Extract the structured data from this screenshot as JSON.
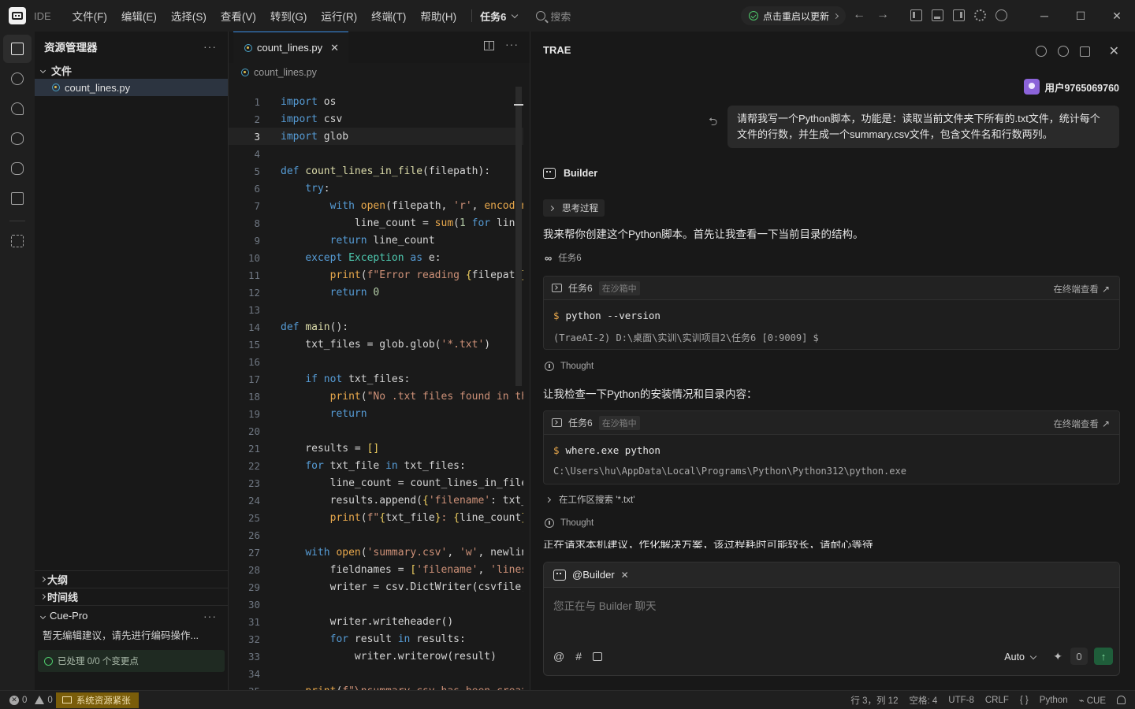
{
  "titlebar": {
    "ide_label": "IDE",
    "menu": [
      "文件(F)",
      "编辑(E)",
      "选择(S)",
      "查看(V)",
      "转到(G)",
      "运行(R)",
      "终端(T)",
      "帮助(H)"
    ],
    "task_title": "任务6",
    "search_placeholder": "搜索",
    "update_text": "点击重启以更新",
    "minimize": "─",
    "maximize": "☐",
    "close": "✕"
  },
  "explorer": {
    "title": "资源管理器",
    "folder": "文件",
    "files": [
      "count_lines.py"
    ],
    "sections": [
      "大纲",
      "时间线"
    ],
    "cue": {
      "title": "Cue-Pro",
      "message": "暂无编辑建议，请先进行编码操作...",
      "status": "已处理 0/0 个变更点"
    }
  },
  "editor": {
    "tab": "count_lines.py",
    "breadcrumb": "count_lines.py",
    "current_line": 3,
    "lines": [
      [
        [
          "kw",
          "import"
        ],
        [
          "t",
          " os"
        ]
      ],
      [
        [
          "kw",
          "import"
        ],
        [
          "t",
          " csv"
        ]
      ],
      [
        [
          "kw",
          "import"
        ],
        [
          "t",
          " glob"
        ]
      ],
      [],
      [
        [
          "kw",
          "def"
        ],
        [
          "t",
          " "
        ],
        [
          "fn",
          "count_lines_in_file"
        ],
        [
          "t",
          "(filepath):"
        ]
      ],
      [
        [
          "t",
          "    "
        ],
        [
          "kw",
          "try"
        ],
        [
          "t",
          ":"
        ]
      ],
      [
        [
          "t",
          "        "
        ],
        [
          "kw",
          "with"
        ],
        [
          "t",
          " "
        ],
        [
          "bi",
          "open"
        ],
        [
          "t",
          "(filepath, "
        ],
        [
          "str",
          "'r'"
        ],
        [
          "t",
          ", "
        ],
        [
          "bi",
          "encoding"
        ],
        [
          "t",
          "="
        ]
      ],
      [
        [
          "t",
          "            line_count = "
        ],
        [
          "bi",
          "sum"
        ],
        [
          "t",
          "("
        ],
        [
          "num",
          "1"
        ],
        [
          "t",
          " "
        ],
        [
          "kw",
          "for"
        ],
        [
          "t",
          " line "
        ],
        [
          "kw",
          "in"
        ]
      ],
      [
        [
          "t",
          "        "
        ],
        [
          "kw",
          "return"
        ],
        [
          "t",
          " line_count"
        ]
      ],
      [
        [
          "t",
          "    "
        ],
        [
          "kw",
          "except"
        ],
        [
          "t",
          " "
        ],
        [
          "cls",
          "Exception"
        ],
        [
          "t",
          " "
        ],
        [
          "kw",
          "as"
        ],
        [
          "t",
          " e:"
        ]
      ],
      [
        [
          "t",
          "        "
        ],
        [
          "bi",
          "print"
        ],
        [
          "t",
          "("
        ],
        [
          "str",
          "f\"Error reading "
        ],
        [
          "br",
          "{"
        ],
        [
          "t",
          "filepath"
        ],
        [
          "br",
          "}"
        ],
        [
          "str",
          ": "
        ]
      ],
      [
        [
          "t",
          "        "
        ],
        [
          "kw",
          "return"
        ],
        [
          "t",
          " "
        ],
        [
          "num",
          "0"
        ]
      ],
      [],
      [
        [
          "kw",
          "def"
        ],
        [
          "t",
          " "
        ],
        [
          "fn",
          "main"
        ],
        [
          "t",
          "():"
        ]
      ],
      [
        [
          "t",
          "    txt_files = glob.glob("
        ],
        [
          "str",
          "'*.txt'"
        ],
        [
          "t",
          ")"
        ]
      ],
      [],
      [
        [
          "t",
          "    "
        ],
        [
          "kw",
          "if"
        ],
        [
          "t",
          " "
        ],
        [
          "kw",
          "not"
        ],
        [
          "t",
          " txt_files:"
        ]
      ],
      [
        [
          "t",
          "        "
        ],
        [
          "bi",
          "print"
        ],
        [
          "t",
          "("
        ],
        [
          "str",
          "\"No .txt files found in the"
        ]
      ],
      [
        [
          "t",
          "        "
        ],
        [
          "kw",
          "return"
        ]
      ],
      [],
      [
        [
          "t",
          "    results = "
        ],
        [
          "br",
          "[]"
        ]
      ],
      [
        [
          "t",
          "    "
        ],
        [
          "kw",
          "for"
        ],
        [
          "t",
          " txt_file "
        ],
        [
          "kw",
          "in"
        ],
        [
          "t",
          " txt_files:"
        ]
      ],
      [
        [
          "t",
          "        line_count = count_lines_in_file(txt"
        ]
      ],
      [
        [
          "t",
          "        results.append("
        ],
        [
          "br",
          "{"
        ],
        [
          "str",
          "'filename'"
        ],
        [
          "t",
          ": txt_fi"
        ]
      ],
      [
        [
          "t",
          "        "
        ],
        [
          "bi",
          "print"
        ],
        [
          "t",
          "("
        ],
        [
          "str",
          "f\""
        ],
        [
          "br",
          "{"
        ],
        [
          "t",
          "txt_file"
        ],
        [
          "br",
          "}"
        ],
        [
          "str",
          ": "
        ],
        [
          "br",
          "{"
        ],
        [
          "t",
          "line_count"
        ],
        [
          "br",
          "}"
        ]
      ],
      [],
      [
        [
          "t",
          "    "
        ],
        [
          "kw",
          "with"
        ],
        [
          "t",
          " "
        ],
        [
          "bi",
          "open"
        ],
        [
          "t",
          "("
        ],
        [
          "str",
          "'summary.csv'"
        ],
        [
          "t",
          ", "
        ],
        [
          "str",
          "'w'"
        ],
        [
          "t",
          ", newline"
        ]
      ],
      [
        [
          "t",
          "        fieldnames = "
        ],
        [
          "br",
          "["
        ],
        [
          "str",
          "'filename'"
        ],
        [
          "t",
          ", "
        ],
        [
          "str",
          "'lines'"
        ],
        [
          "br",
          "]"
        ]
      ],
      [
        [
          "t",
          "        writer = csv.DictWriter(csvfile, f"
        ]
      ],
      [],
      [
        [
          "t",
          "        writer.writeheader()"
        ]
      ],
      [
        [
          "t",
          "        "
        ],
        [
          "kw",
          "for"
        ],
        [
          "t",
          " result "
        ],
        [
          "kw",
          "in"
        ],
        [
          "t",
          " results:"
        ]
      ],
      [
        [
          "t",
          "            writer.writerow(result)"
        ]
      ],
      [],
      [
        [
          "t",
          "    "
        ],
        [
          "bi",
          "print"
        ],
        [
          "t",
          "("
        ],
        [
          "str",
          "f\"\\nsummary.csv has been created"
        ]
      ]
    ]
  },
  "ai_panel": {
    "title": "TRAE",
    "user_name": "用户9765069760",
    "user_message": "请帮我写一个Python脚本，功能是：读取当前文件夹下所有的.txt文件，统计每个文件的行数，并生成一个summary.csv文件，包含文件名和行数两列。",
    "agent_name": "Builder",
    "thinking_label": "思考过程",
    "reply_1": "我来帮你创建这个Python脚本。首先让我查看一下当前目录的结构。",
    "task_ref": "任务6",
    "terminal_1": {
      "task": "任务6",
      "tag": "在沙箱中",
      "open_label": "在终端查看",
      "command": "python --version",
      "output": "(TraeAI-2) D:\\桌面\\实训\\实训项目2\\任务6 [0:9009] $"
    },
    "thought_label": "Thought",
    "reply_2": "让我检查一下Python的安装情况和目录内容：",
    "terminal_2": {
      "task": "任务6",
      "tag": "在沙箱中",
      "open_label": "在终端查看",
      "command": "where.exe python",
      "output": "C:\\Users\\hu\\AppData\\Local\\Programs\\Python\\Python312\\python.exe"
    },
    "search_label": "在工作区搜索 '*.txt'",
    "thought_label_2": "Thought",
    "truncated_reply": "正在请求本机建议，作化解决方案，该过程耗时可能较长，请耐心等待",
    "input": {
      "mention": "@Builder",
      "placeholder": "您正在与 Builder 聊天",
      "tools": [
        "@",
        "#"
      ],
      "model": "Auto",
      "send": "↑"
    }
  },
  "statusbar": {
    "errors": "0",
    "warnings": "0",
    "resource_warning": "系统资源紧张",
    "cursor": "行 3，列 12",
    "spaces": "空格: 4",
    "encoding": "UTF-8",
    "eol": "CRLF",
    "braces": "{ }",
    "language": "Python",
    "cue": "CUE"
  },
  "colors": {
    "accent": "#3a8ee6",
    "send": "#1f5d3a",
    "warning": "#7a5d0a",
    "avatar": "#8b63d9"
  }
}
